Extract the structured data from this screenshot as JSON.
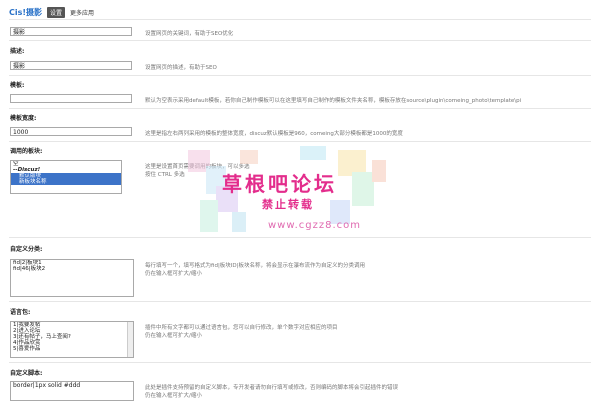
{
  "header": {
    "title": "Cis!摄影",
    "tab_active": "设置",
    "tab_more": "更多应用"
  },
  "fields": [
    {
      "label": "",
      "value": "摄影",
      "hint": "设置网页的关键词，有助于SEO优化"
    },
    {
      "label": "描述:",
      "value": "摄影",
      "hint": "设置网页的描述，有助于SEO"
    },
    {
      "label": "模板:",
      "value": "",
      "hint": "默认为空表示采用default模板，若你自己制作模板可以在这里填写自己制作的模板文件夹名称，模板存放在source\\plugin\\comeing_photo\\template\\pi"
    },
    {
      "label": "模板宽度:",
      "value": "1000",
      "hint": "这里是指左右两列采用的模板的整体宽度，discuz默认模板是960，comeing大部分模板都是1000的宽度"
    }
  ],
  "board_select": {
    "label": "调用的板块:",
    "options": [
      {
        "text": "空",
        "type": "normal"
      },
      {
        "text": "--Discuz!",
        "type": "group"
      },
      {
        "text": "默认版块",
        "type": "selected"
      },
      {
        "text": "新板块名称",
        "type": "selected"
      }
    ],
    "hint1": "这里是设置首页需要调用的板块，可以多选",
    "hint2": "按住 CTRL 多选"
  },
  "custom_category": {
    "label": "自定义分类:",
    "lines": [
      "fid|2|板块1",
      "fid|46|板块2"
    ],
    "hint1": "每行填写一个，填写格式为fid|板块ID|板块名称，将会显示在瀑布流作为自定义的分类调用",
    "hint2": "仍在输入框可扩大/缩小"
  },
  "lang_pack": {
    "label": "语言包:",
    "lines": [
      "1|我要发帖",
      "2|进入论坛",
      "3|还有帖子，马上查阅?",
      "4|作品欣赏",
      "5|喜爱作品"
    ],
    "hint1": "插件中所有文字都可以通过语言包，您可以自行修改，单个数字对应相应的项目",
    "hint2": "仍在输入框可扩大/缩小"
  },
  "custom_script": {
    "label": "自定义脚本:",
    "value": "border|1px solid #ddd",
    "hint1": "此处是插件支持预留的自定义脚本，专开发者请勿自行填写或修改，否则编码的脚本将会引起插件的错误",
    "hint2": "仍在输入框可扩大/缩小"
  },
  "watermark": {
    "line1": "草根吧论坛",
    "line2": "禁止转载",
    "line3": "www.cgzz8.com"
  }
}
